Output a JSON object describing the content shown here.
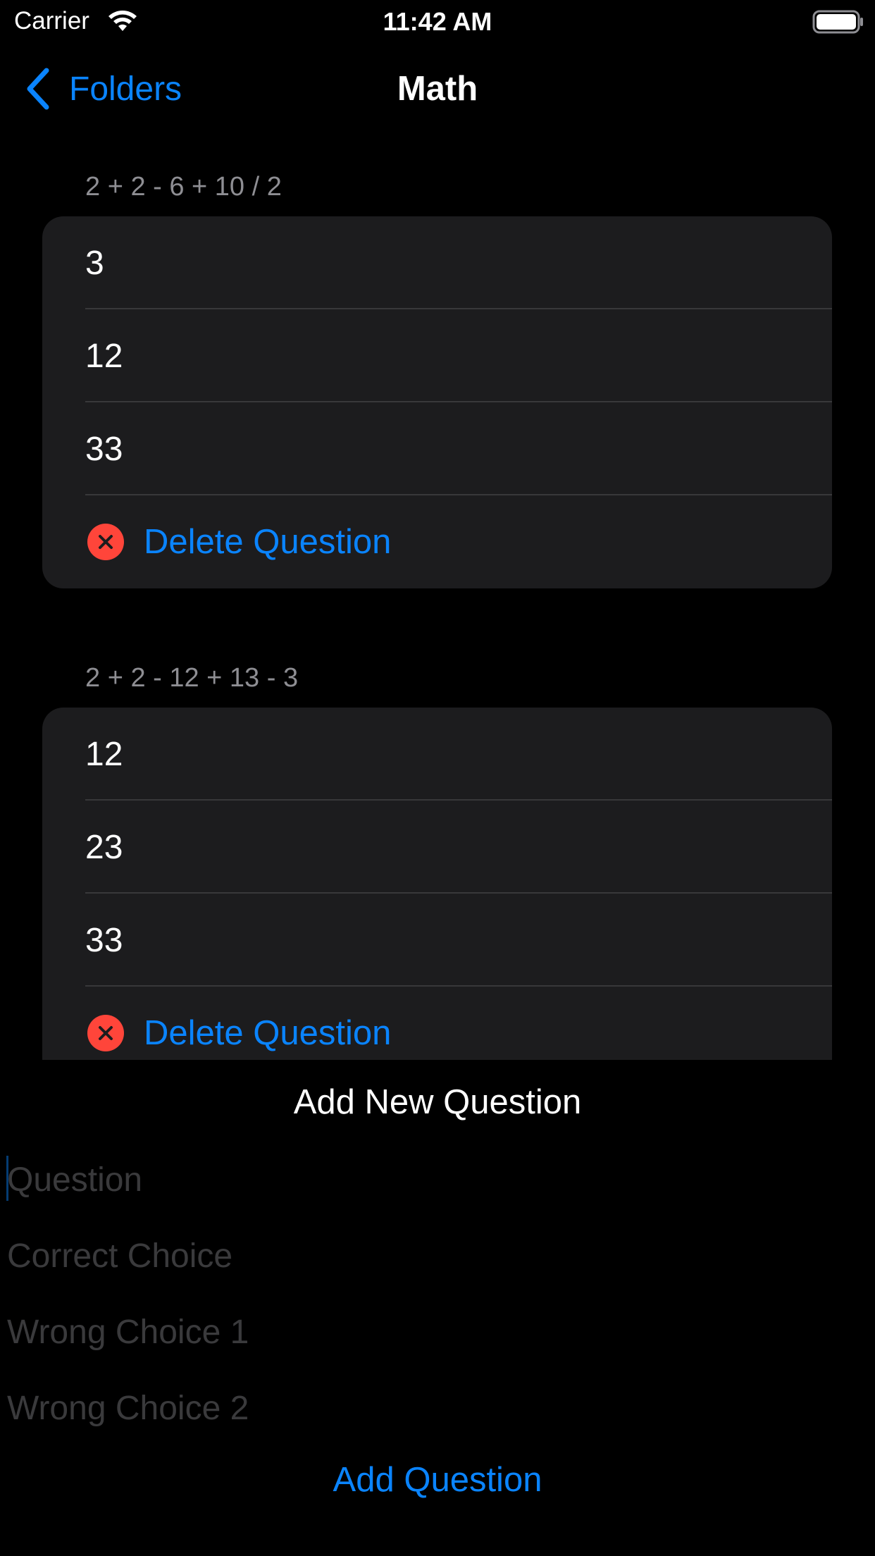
{
  "status_bar": {
    "carrier": "Carrier",
    "time": "11:42 AM",
    "wifi_icon": "wifi-icon",
    "battery_icon": "battery-icon"
  },
  "nav": {
    "back_label": "Folders",
    "back_icon": "chevron-left-icon",
    "title": "Math"
  },
  "questions": [
    {
      "question": "2 + 2 - 6 + 10 / 2",
      "choices": [
        "3",
        "12",
        "33"
      ],
      "delete_label": "Delete Question"
    },
    {
      "question": "2 + 2 - 12 + 13 - 3",
      "choices": [
        "12",
        "23",
        "33"
      ],
      "delete_label": "Delete Question"
    }
  ],
  "add_form": {
    "title": "Add New Question",
    "question_placeholder": "Question",
    "correct_placeholder": "Correct Choice",
    "wrong1_placeholder": "Wrong Choice 1",
    "wrong2_placeholder": "Wrong Choice 2",
    "submit_label": "Add Question"
  },
  "colors": {
    "accent": "#0a84ff",
    "destructive": "#ff453a",
    "background": "#000000",
    "cell_background": "#1c1c1e",
    "secondary_text": "#8e8e93"
  }
}
